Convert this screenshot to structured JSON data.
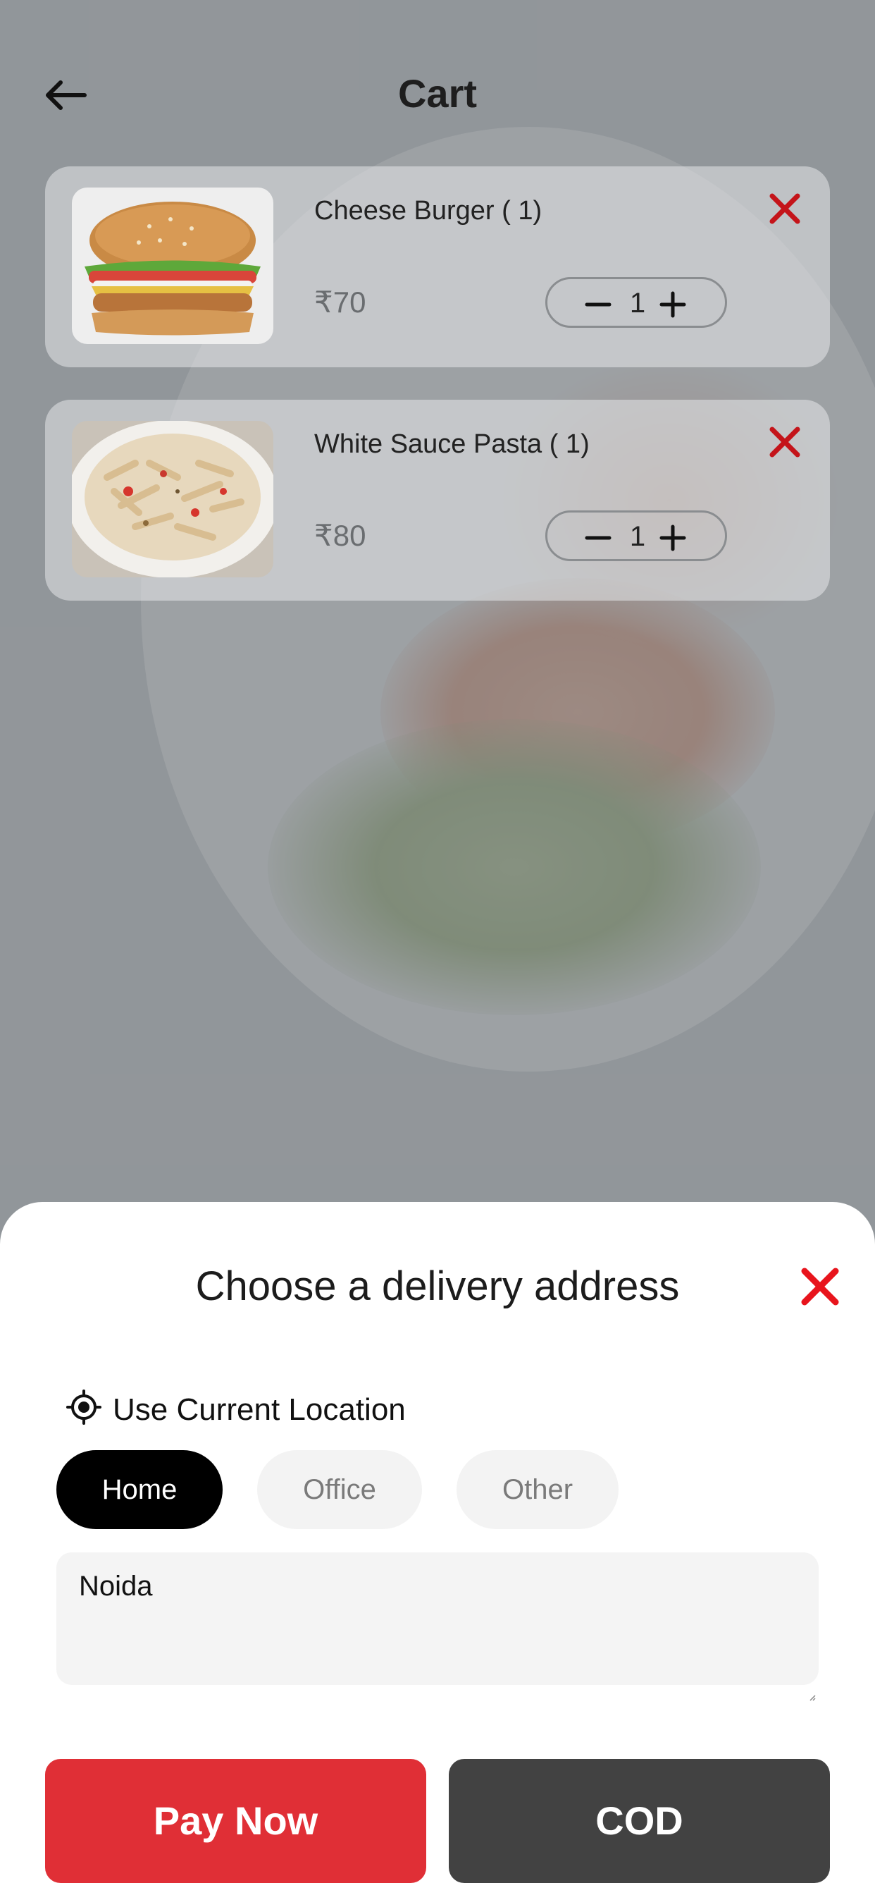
{
  "header": {
    "title": "Cart"
  },
  "cart": {
    "items": [
      {
        "name": "Cheese Burger ( 1)",
        "price": "₹70",
        "quantity": "1",
        "image": "burger"
      },
      {
        "name": "White Sauce Pasta ( 1)",
        "price": "₹80",
        "quantity": "1",
        "image": "pasta"
      }
    ]
  },
  "delivery_sheet": {
    "title": "Choose a delivery address",
    "use_location_label": "Use Current Location",
    "address_types": [
      "Home",
      "Office",
      "Other"
    ],
    "selected_type": "Home",
    "address_value": "Noida"
  },
  "actions": {
    "pay_now": "Pay Now",
    "cod": "COD"
  },
  "colors": {
    "accent_red": "#e02f36",
    "close_red": "#e8141c",
    "cod_dark": "#424242",
    "chip_active": "#000000",
    "chip_idle": "#f3f3f3"
  }
}
